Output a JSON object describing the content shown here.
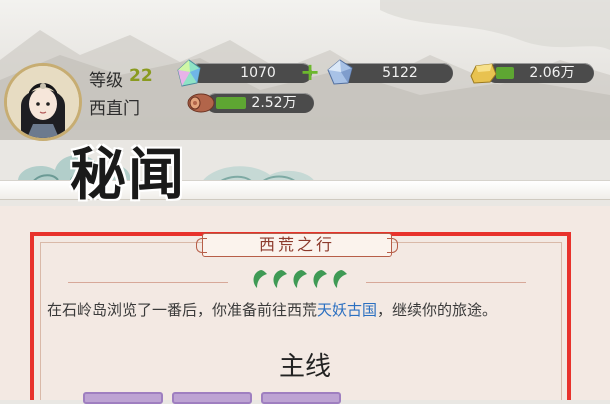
{
  "player": {
    "level_label": "等级",
    "level": "22",
    "location": "西直门"
  },
  "resources": [
    {
      "icon": "spirit-crystal-icon",
      "value": "1070",
      "has_add": true
    },
    {
      "icon": "blue-gem-icon",
      "value": "5122"
    },
    {
      "icon": "gold-ingot-icon",
      "value": "2.06万",
      "fill": 0.2
    },
    {
      "icon": "wood-log-icon",
      "value": "2.52万",
      "fill": 0.2
    }
  ],
  "banner": {
    "title": "秘闻"
  },
  "event": {
    "chapter_title": "西荒之行",
    "progress_leaves": 5,
    "text_before": "在石岭岛浏览了一番后，你准备前往西荒",
    "text_highlight": "天妖古国",
    "text_after": "，继续你的旅途。",
    "quest_type": "主线"
  },
  "colors": {
    "highlight": "#e8322c",
    "leaf": "#3f9a55",
    "link": "#2a6fc1",
    "level": "#8a9b20"
  }
}
